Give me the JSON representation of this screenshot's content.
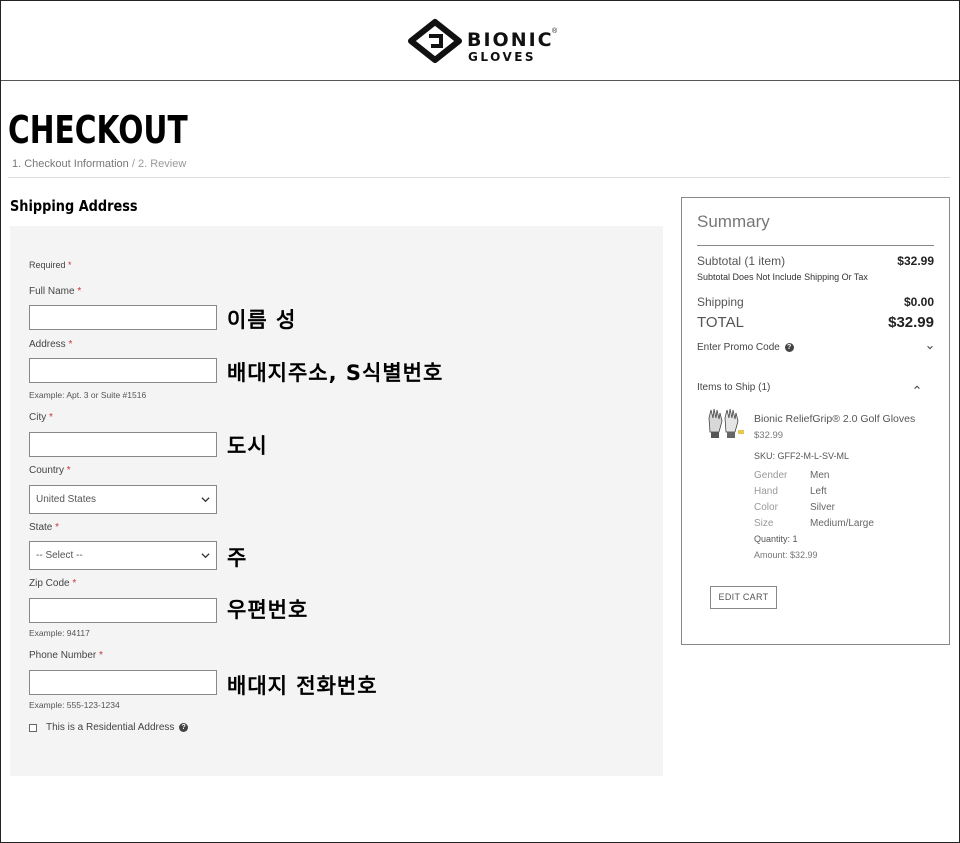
{
  "brand": {
    "line1": "BIONIC",
    "line2": "GLOVES",
    "reg_mark": "®"
  },
  "page": {
    "title": "CHECKOUT",
    "breadcrumb": {
      "step1": "1. Checkout Information",
      "separator": "/",
      "step2": "2. Review"
    },
    "section_title": "Shipping Address"
  },
  "form": {
    "required_label": "Required",
    "required_star": "*",
    "full_name": {
      "label": "Full Name",
      "value": "",
      "annotation": "이름 성"
    },
    "address": {
      "label": "Address",
      "value": "",
      "hint": "Example: Apt. 3 or Suite #1516",
      "annotation": "배대지주소, S식별번호"
    },
    "city": {
      "label": "City",
      "value": "",
      "annotation": "도시"
    },
    "country": {
      "label": "Country",
      "selected": "United States"
    },
    "state": {
      "label": "State",
      "selected": "-- Select --",
      "annotation": "주"
    },
    "zip": {
      "label": "Zip Code",
      "value": "",
      "hint": "Example: 94117",
      "annotation": "우편번호"
    },
    "phone": {
      "label": "Phone Number",
      "value": "",
      "hint": "Example: 555-123-1234",
      "annotation": "배대지 전화번호"
    },
    "residential": {
      "label": "This is a Residential Address",
      "checked": false
    }
  },
  "summary": {
    "title": "Summary",
    "subtotal_label": "Subtotal",
    "subtotal_count": "(1 item)",
    "subtotal_value": "$32.99",
    "subtotal_note": "Subtotal Does Not Include Shipping Or Tax",
    "shipping_label": "Shipping",
    "shipping_value": "$0.00",
    "total_label": "TOTAL",
    "total_value": "$32.99",
    "promo_label": "Enter Promo Code",
    "items_label": "Items to Ship (1)",
    "item": {
      "name": "Bionic ReliefGrip® 2.0 Golf Gloves",
      "price": "$32.99",
      "sku": "SKU: GFF2-M-L-SV-ML",
      "attributes": [
        {
          "name": "Gender",
          "value": "Men"
        },
        {
          "name": "Hand",
          "value": "Left"
        },
        {
          "name": "Color",
          "value": "Silver"
        },
        {
          "name": "Size",
          "value": "Medium/Large"
        }
      ],
      "quantity": "Quantity: 1",
      "amount": "Amount: $32.99"
    },
    "edit_cart_label": "EDIT CART"
  },
  "icons": {
    "logo": "bionic-diamond-logo",
    "help": "question-circle-icon",
    "chevron": "chevron-down-icon",
    "chevron_up": "chevron-up-icon"
  }
}
